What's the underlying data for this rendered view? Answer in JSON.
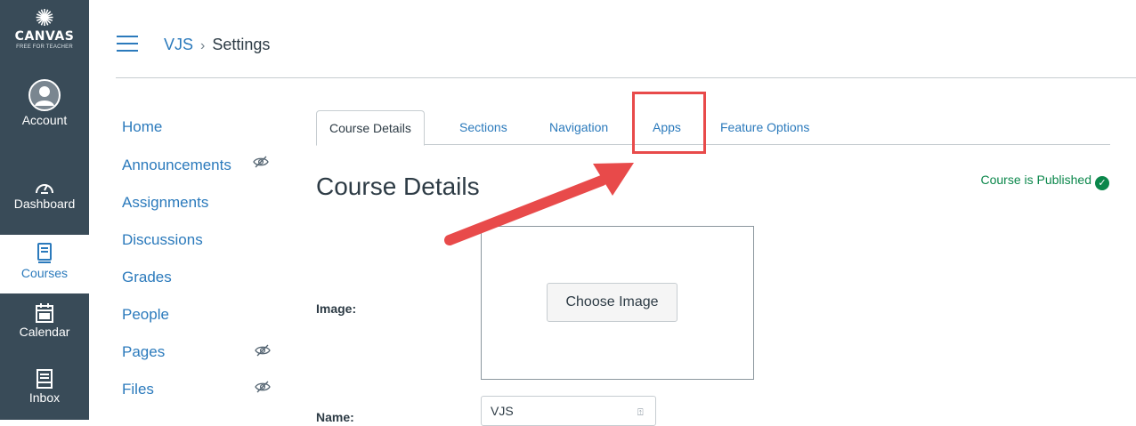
{
  "global_nav": {
    "logo": {
      "word": "CANVAS",
      "sub": "FREE FOR TEACHER",
      "icon": "canvas-logo-icon"
    },
    "items": [
      {
        "label": "Account",
        "icon": "user-avatar-icon",
        "active": false
      },
      {
        "label": "Dashboard",
        "icon": "dashboard-gauge-icon",
        "active": false
      },
      {
        "label": "Courses",
        "icon": "book-icon",
        "active": true
      },
      {
        "label": "Calendar",
        "icon": "calendar-icon",
        "active": false
      },
      {
        "label": "Inbox",
        "icon": "inbox-icon",
        "active": false
      }
    ]
  },
  "header": {
    "breadcrumb": {
      "course": "VJS",
      "separator": "›",
      "current": "Settings"
    }
  },
  "course_nav": {
    "items": [
      {
        "label": "Home",
        "hidden": false
      },
      {
        "label": "Announcements",
        "hidden": true
      },
      {
        "label": "Assignments",
        "hidden": false
      },
      {
        "label": "Discussions",
        "hidden": false
      },
      {
        "label": "Grades",
        "hidden": false
      },
      {
        "label": "People",
        "hidden": false
      },
      {
        "label": "Pages",
        "hidden": true
      },
      {
        "label": "Files",
        "hidden": true
      }
    ]
  },
  "tabs": [
    {
      "label": "Course Details",
      "active": true
    },
    {
      "label": "Sections",
      "active": false
    },
    {
      "label": "Navigation",
      "active": false
    },
    {
      "label": "Apps",
      "active": false,
      "highlighted": true
    },
    {
      "label": "Feature Options",
      "active": false
    }
  ],
  "content": {
    "title": "Course Details",
    "status": "Course is Published",
    "image_label": "Image:",
    "choose_image": "Choose Image",
    "name_label": "Name:",
    "name_value": "VJS"
  },
  "colors": {
    "nav_bg": "#394b58",
    "link": "#2b7abc",
    "published": "#0b874b",
    "annotation": "#e84a4a"
  }
}
